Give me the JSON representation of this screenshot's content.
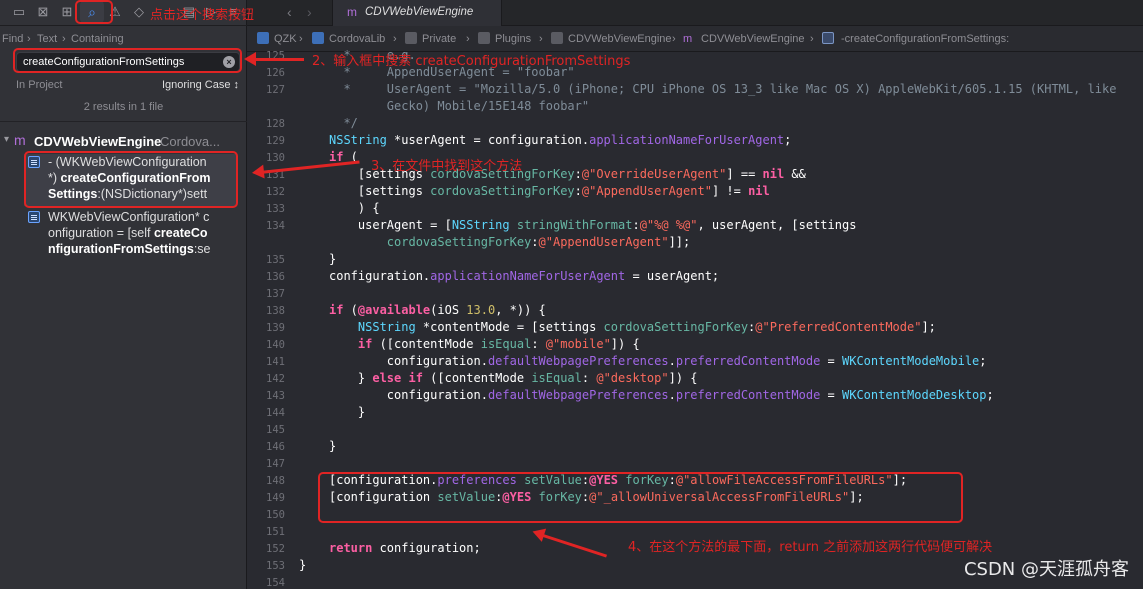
{
  "navigator": {
    "find_label": "Find",
    "text_label": "Text",
    "containing_label": "Containing",
    "search_value": "createConfigurationFromSettings",
    "scope_label": "In Project",
    "case_label": "Ignoring Case ↕",
    "results_count": "2 results in 1 file",
    "group": {
      "name": "CDVWebViewEngine",
      "sub": "Cordova..."
    },
    "results": [
      {
        "line1": "- (WKWebViewConfiguration",
        "line2_pre": "*) ",
        "line2_bold": "createConfigurationFrom",
        "line3_bold": "Settings",
        "line3_post": ":(NSDictionary*)sett"
      },
      {
        "line1": "WKWebViewConfiguration* c",
        "line2_pre": "onfiguration = [self ",
        "line2_bold": "createCo",
        "line3_bold": "nfigurationFromSettings",
        "line3_post": ":se"
      }
    ]
  },
  "tab": {
    "label": "CDVWebViewEngine"
  },
  "jumpbar": {
    "items": [
      "QZK",
      "CordovaLib",
      "Private",
      "Plugins",
      "CDVWebViewEngine",
      "CDVWebViewEngine",
      "-createConfigurationFromSettings:"
    ]
  },
  "annotations": {
    "note1": "点击这个搜索按钮",
    "note2": "2、输入框中搜索 createConfigurationFromSettings",
    "note3": "3、在文件中找到这个方法",
    "note4": "4、在这个方法的最下面，return 之前添加这两行代码便可解决"
  },
  "watermark": "CSDN @天涯孤舟客",
  "code_lines": [
    {
      "n": "125",
      "html": "<span class='cm'>  *     e.g.</span>"
    },
    {
      "n": "126",
      "html": "<span class='cm'>  *     AppendUserAgent = \"foobar\"</span>"
    },
    {
      "n": "127",
      "html": "<span class='cm'>  *     UserAgent = \"Mozilla/5.0 (iPhone; CPU iPhone OS 13_3 like Mac OS X) AppleWebKit/605.1.15 (KHTML, like</span>"
    },
    {
      "n": "",
      "html": "<span class='cm'>        Gecko) Mobile/15E148 foobar\"</span>"
    },
    {
      "n": "128",
      "html": "<span class='cm'>  */</span>"
    },
    {
      "n": "129",
      "html": "<span class='ty'>NSString</span> *userAgent = configuration.<span class='pr'>applicationNameForUserAgent</span>;"
    },
    {
      "n": "130",
      "html": "<span class='kw'>if</span> ("
    },
    {
      "n": "131",
      "html": "    [settings <span class='me'>cordovaSettingForKey</span>:<span class='st'>@\"OverrideUserAgent\"</span>] == <span class='kw'>nil</span> &amp;&amp;"
    },
    {
      "n": "132",
      "html": "    [settings <span class='me'>cordovaSettingForKey</span>:<span class='st'>@\"AppendUserAgent\"</span>] != <span class='kw'>nil</span>"
    },
    {
      "n": "133",
      "html": "    ) {"
    },
    {
      "n": "134",
      "html": "    userAgent = [<span class='ty'>NSString</span> <span class='me'>stringWithFormat</span>:<span class='st'>@\"%@ %@\"</span>, userAgent, [settings"
    },
    {
      "n": "",
      "html": "        <span class='me'>cordovaSettingForKey</span>:<span class='st'>@\"AppendUserAgent\"</span>]];"
    },
    {
      "n": "135",
      "html": "}"
    },
    {
      "n": "136",
      "html": "configuration.<span class='pr'>applicationNameForUserAgent</span> = userAgent;"
    },
    {
      "n": "137",
      "html": ""
    },
    {
      "n": "138",
      "html": "<span class='kw'>if</span> (<span class='kw'>@available</span>(iOS <span class='nm'>13.0</span>, *)) {"
    },
    {
      "n": "139",
      "html": "    <span class='ty'>NSString</span> *contentMode = [settings <span class='me'>cordovaSettingForKey</span>:<span class='st'>@\"PreferredContentMode\"</span>];"
    },
    {
      "n": "140",
      "html": "    <span class='kw'>if</span> ([contentMode <span class='me'>isEqual</span>: <span class='st'>@\"mobile\"</span>]) {"
    },
    {
      "n": "141",
      "html": "        configuration.<span class='pr'>defaultWebpagePreferences</span>.<span class='pr'>preferredContentMode</span> = <span class='ty'>WKContentModeMobile</span>;"
    },
    {
      "n": "142",
      "html": "    } <span class='kw'>else if</span> ([contentMode <span class='me'>isEqual</span>: <span class='st'>@\"desktop\"</span>]) {"
    },
    {
      "n": "143",
      "html": "        configuration.<span class='pr'>defaultWebpagePreferences</span>.<span class='pr'>preferredContentMode</span> = <span class='ty'>WKContentModeDesktop</span>;"
    },
    {
      "n": "144",
      "html": "    }"
    },
    {
      "n": "145",
      "html": ""
    },
    {
      "n": "146",
      "html": "}"
    },
    {
      "n": "147",
      "html": ""
    },
    {
      "n": "148",
      "html": "[configuration.<span class='pr'>preferences</span> <span class='me'>setValue</span>:<span class='kw'>@YES</span> <span class='me'>forKey</span>:<span class='st'>@\"allowFileAccessFromFileURLs\"</span>];"
    },
    {
      "n": "149",
      "html": "[configuration <span class='me'>setValue</span>:<span class='kw'>@YES</span> <span class='me'>forKey</span>:<span class='st'>@\"_allowUniversalAccessFromFileURLs\"</span>];"
    },
    {
      "n": "150",
      "html": ""
    },
    {
      "n": "151",
      "html": ""
    },
    {
      "n": "152",
      "html": "<span class='kw'>return</span> configuration;"
    },
    {
      "n": "153",
      "html": "}"
    },
    {
      "n": "154",
      "html": ""
    }
  ]
}
